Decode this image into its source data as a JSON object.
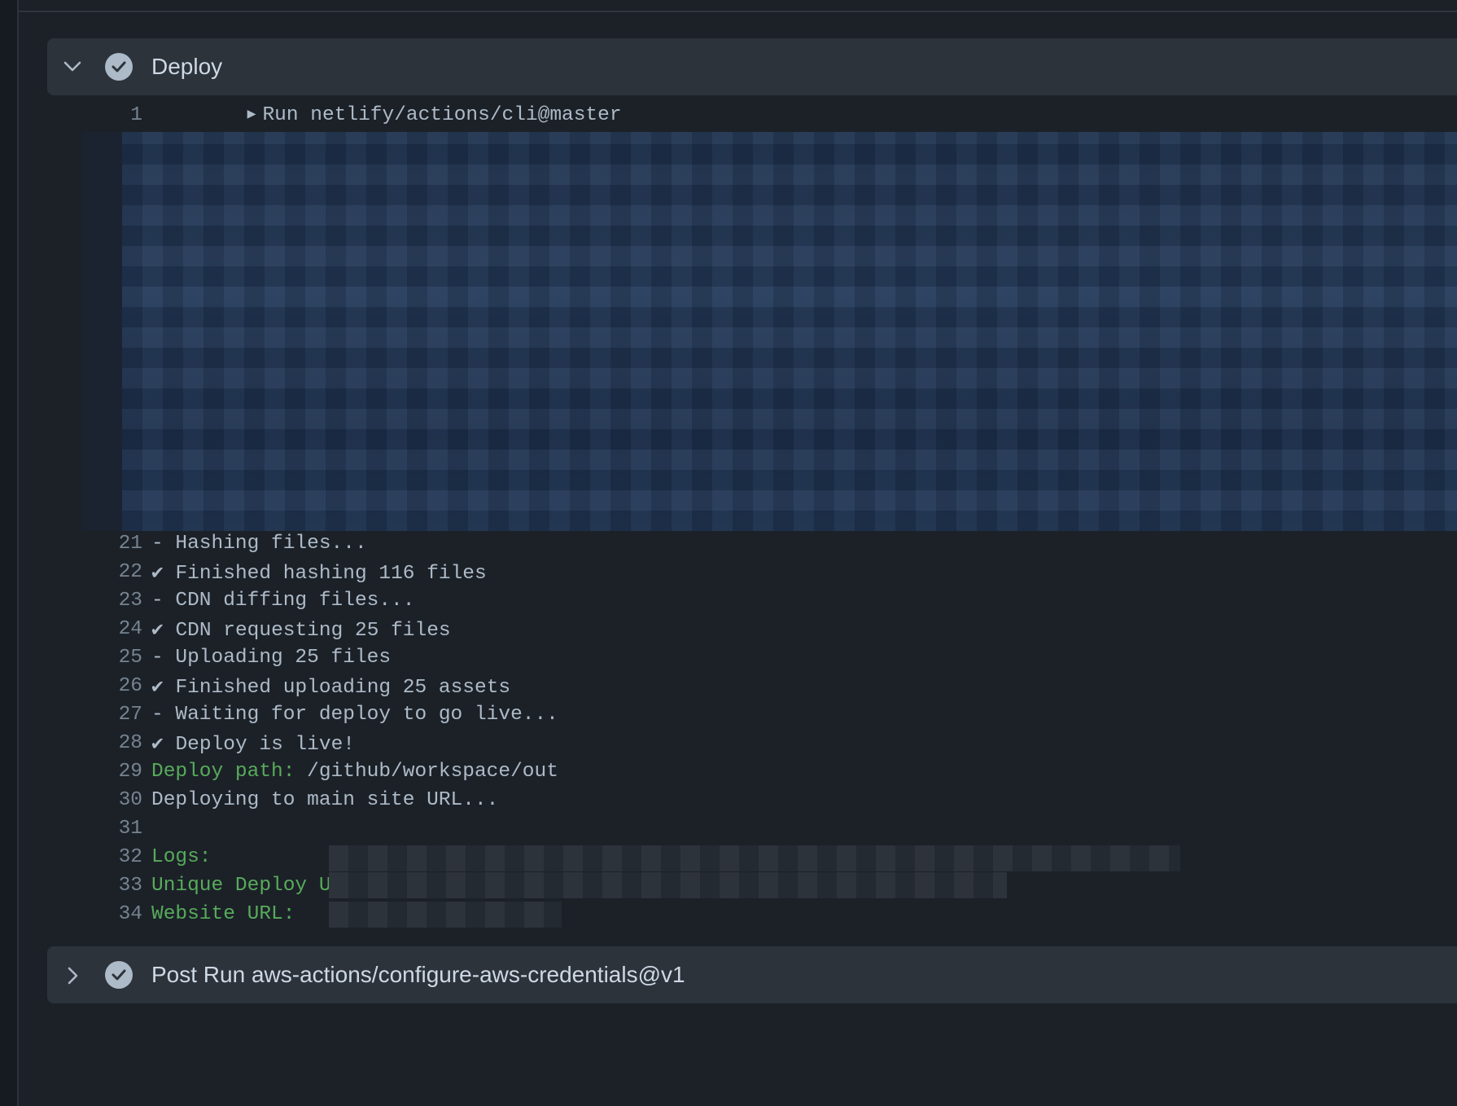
{
  "step": {
    "title": "Deploy",
    "status": "success",
    "expanded": true
  },
  "log": {
    "group_line": {
      "number": "1",
      "text": "Run netlify/actions/cli@master"
    },
    "lines": [
      {
        "number": "21",
        "text": "- Hashing files..."
      },
      {
        "number": "22",
        "text": "✔ Finished hashing 116 files"
      },
      {
        "number": "23",
        "text": "- CDN diffing files..."
      },
      {
        "number": "24",
        "text": "✔ CDN requesting 25 files"
      },
      {
        "number": "25",
        "text": "- Uploading 25 files"
      },
      {
        "number": "26",
        "text": "✔ Finished uploading 25 assets"
      },
      {
        "number": "27",
        "text": "- Waiting for deploy to go live..."
      },
      {
        "number": "28",
        "text": "✔ Deploy is live!"
      }
    ],
    "deploy_path": {
      "number": "29",
      "label": "Deploy path:",
      "value": " /github/workspace/out"
    },
    "deploying": {
      "number": "30",
      "text": "Deploying to main site URL..."
    },
    "blank": {
      "number": "31"
    },
    "logs": {
      "number": "32",
      "label": "Logs:"
    },
    "unique_url": {
      "number": "33",
      "label": "Unique Deploy URL:"
    },
    "website_url": {
      "number": "34",
      "label": "Website URL:"
    }
  },
  "next_step": {
    "title": "Post Run aws-actions/configure-aws-credentials@v1"
  },
  "colors": {
    "background": "#1c2128",
    "header": "#2d333b",
    "text": "#adbac7",
    "line_number": "#768390",
    "green": "#57ab5a"
  }
}
